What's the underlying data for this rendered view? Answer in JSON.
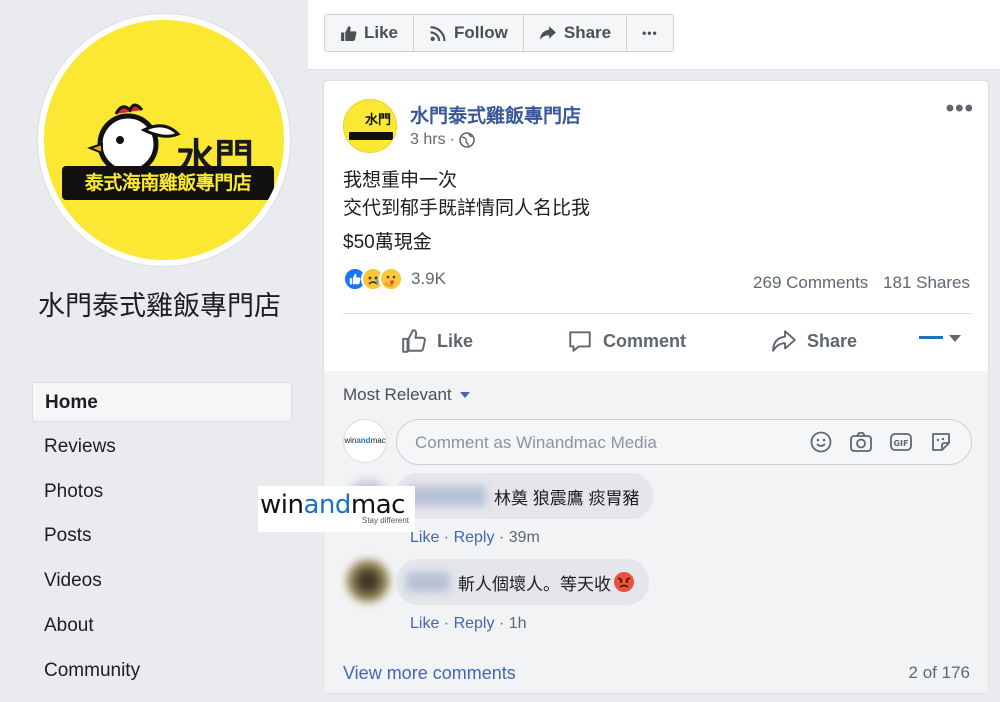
{
  "page": {
    "name": "水門泰式雞飯專門店",
    "logo": {
      "main": "水門",
      "sub": "泰式海南雞飯專門店"
    }
  },
  "nav": {
    "items": [
      {
        "label": "Home",
        "active": true
      },
      {
        "label": "Reviews"
      },
      {
        "label": "Photos"
      },
      {
        "label": "Posts"
      },
      {
        "label": "Videos"
      },
      {
        "label": "About"
      },
      {
        "label": "Community"
      }
    ]
  },
  "topbar": {
    "like_label": "Like",
    "follow_label": "Follow",
    "share_label": "Share",
    "more_label": "•••"
  },
  "post": {
    "author": "水門泰式雞飯專門店",
    "time": "3 hrs",
    "time_separator": "·",
    "lines": [
      "我想重申一次",
      "交代到郁手既詳情同人名比我",
      "$50萬現金"
    ],
    "reactions_count": "3.9K",
    "reaction_icons": [
      "like-reaction-icon",
      "sad-reaction-icon",
      "care-reaction-icon"
    ],
    "comments_count": "269 Comments",
    "shares_count": "181 Shares",
    "more_label": "•••"
  },
  "actions": {
    "like": "Like",
    "comment": "Comment",
    "share": "Share"
  },
  "comments": {
    "sort_label": "Most Relevant",
    "input_placeholder": "Comment as Winandmac Media",
    "me_avatar_text_a": "win",
    "me_avatar_text_b": "and",
    "me_avatar_text_c": "mac",
    "items": [
      {
        "text": "林奠 狼震鷹 痰胃豬",
        "like": "Like",
        "reply": "Reply",
        "time": "39m"
      },
      {
        "text": "斬人個壞人。等天收",
        "like": "Like",
        "reply": "Reply",
        "time": "1h"
      }
    ],
    "view_more": "View more comments",
    "pager": "2 of 176"
  },
  "watermark": {
    "win": "win",
    "and": "and",
    "mac": "mac",
    "tagline": "Stay different"
  },
  "colors": {
    "link": "#385898",
    "accent": "#1877f2",
    "logo_yellow": "#fbe832"
  }
}
